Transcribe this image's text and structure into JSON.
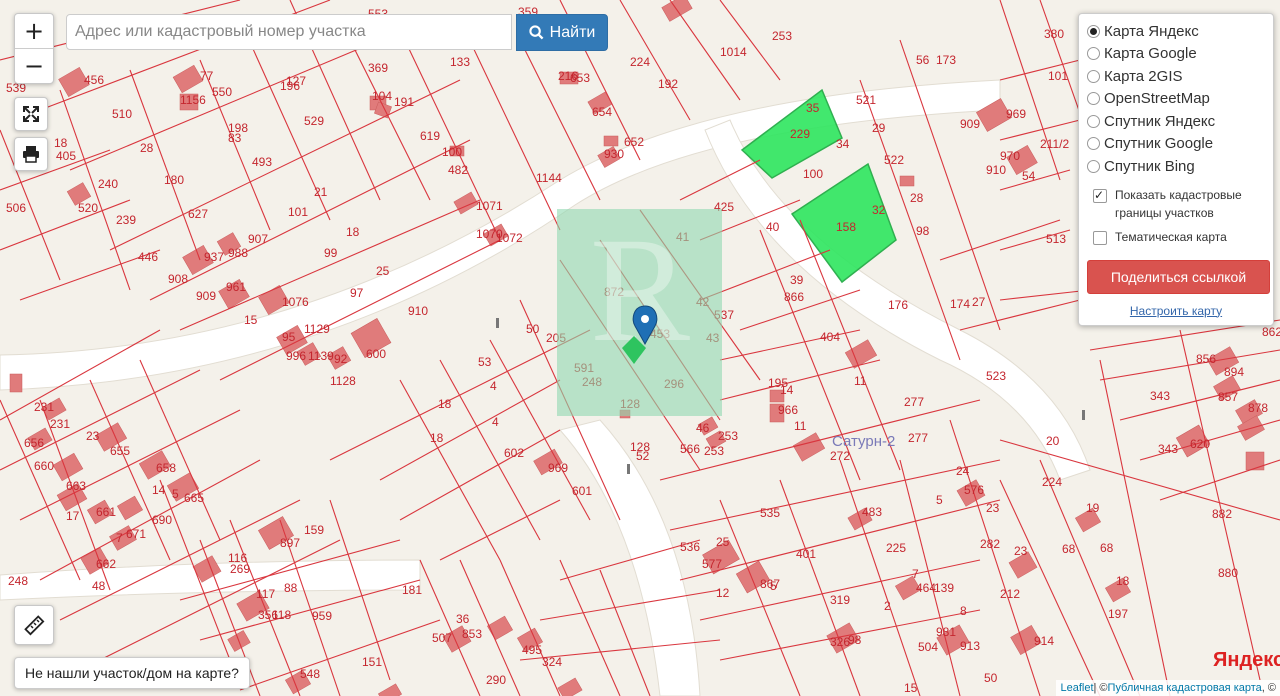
{
  "search": {
    "placeholder": "Адрес или кадастровый номер участка",
    "button_label": "Найти"
  },
  "zoom": {
    "in": "+",
    "out": "−"
  },
  "icons": {
    "fullscreen": "fullscreen-icon",
    "print": "printer-icon",
    "ruler": "ruler-icon",
    "search": "search-icon"
  },
  "layers": {
    "options": [
      {
        "label": "Карта Яндекс",
        "selected": true
      },
      {
        "label": "Карта Google",
        "selected": false
      },
      {
        "label": "Карта 2GIS",
        "selected": false
      },
      {
        "label": "OpenStreetMap",
        "selected": false
      },
      {
        "label": "Спутник Яндекс",
        "selected": false
      },
      {
        "label": "Спутник Google",
        "selected": false
      },
      {
        "label": "Спутник Bing",
        "selected": false
      }
    ],
    "show_cadastral_label": "Показать кадастровые границы участков",
    "show_cadastral_checked": true,
    "thematic_label": "Тематическая карта",
    "thematic_checked": false,
    "share_button": "Поделиться ссылкой",
    "configure_link": "Настроить карту"
  },
  "not_found_label": "Не нашли участок/дом на карте?",
  "attribution": {
    "leaflet": "Leaflet",
    "sep": " | © ",
    "source": "Публичная кадастровая карта",
    "tail": ", ©"
  },
  "map": {
    "brand": "Яндекс",
    "district_label": "Сатурн-2",
    "colors": {
      "parcel_border": "#d9363e",
      "building": "#e07b7b",
      "highlight": "#2ee65f",
      "selection": "#7fd4a6",
      "marker": "#1f6fb5",
      "background": "#f4f1ea"
    },
    "parcel_numbers": [
      "539",
      "456",
      "77",
      "1156",
      "550",
      "196",
      "127",
      "369",
      "104",
      "191",
      "133",
      "553",
      "359",
      "216",
      "653",
      "224",
      "192",
      "654",
      "652",
      "930",
      "1014",
      "253",
      "380",
      "56",
      "173",
      "101",
      "909",
      "969",
      "211/2",
      "910",
      "970",
      "54",
      "35",
      "229",
      "521",
      "29",
      "34",
      "522",
      "18",
      "405",
      "510",
      "28",
      "198",
      "83",
      "493",
      "529",
      "619",
      "100",
      "482",
      "1144",
      "240",
      "520",
      "506",
      "180",
      "21",
      "101",
      "627",
      "239",
      "1071",
      "1070",
      "1072",
      "425",
      "41",
      "40",
      "100",
      "158",
      "32",
      "28",
      "98",
      "513",
      "446",
      "908",
      "937",
      "988",
      "907",
      "909",
      "961",
      "99",
      "18",
      "25",
      "97",
      "1076",
      "910",
      "15",
      "95",
      "1129",
      "996",
      "92",
      "1139",
      "1128",
      "600",
      "872",
      "42",
      "537",
      "43",
      "39",
      "866",
      "404",
      "176",
      "174",
      "27",
      "523",
      "862",
      "856",
      "894",
      "857",
      "878",
      "53",
      "50",
      "205",
      "248",
      "128",
      "296",
      "453",
      "11",
      "195",
      "14",
      "966",
      "343",
      "343",
      "620",
      "4",
      "18",
      "18",
      "4",
      "602",
      "969",
      "601",
      "128",
      "52",
      "566",
      "46",
      "253",
      "253",
      "591",
      "11",
      "272",
      "277",
      "277",
      "20",
      "224",
      "882",
      "231",
      "231",
      "656",
      "23",
      "655",
      "660",
      "658",
      "14",
      "5",
      "665",
      "663",
      "17",
      "661",
      "690",
      "671",
      "662",
      "7",
      "48",
      "159",
      "897",
      "535",
      "536",
      "25",
      "577",
      "401",
      "483",
      "225",
      "24",
      "576",
      "5",
      "23",
      "282",
      "19",
      "68",
      "68",
      "880",
      "248",
      "116",
      "269",
      "117",
      "88",
      "356",
      "118",
      "959",
      "181",
      "12",
      "867",
      "5",
      "319",
      "7",
      "464",
      "139",
      "8",
      "23",
      "212",
      "197",
      "18",
      "36",
      "507",
      "853",
      "495",
      "151",
      "324",
      "326",
      "98",
      "2",
      "504",
      "981",
      "913",
      "914",
      "50",
      "548",
      "290",
      "15"
    ]
  }
}
